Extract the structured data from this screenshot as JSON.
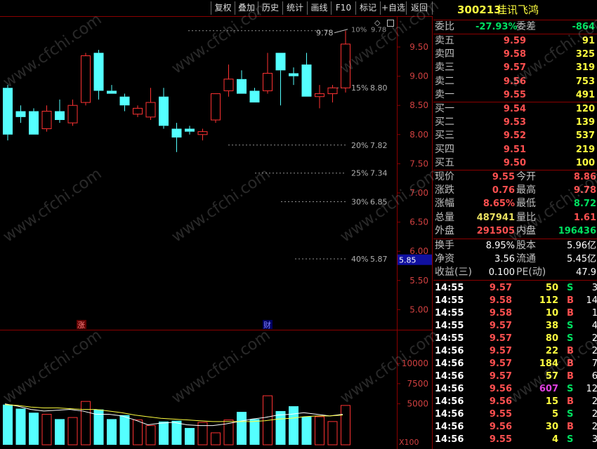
{
  "toolbar": {
    "items": [
      "复权",
      "叠加",
      "历史",
      "统计",
      "画线",
      "F10",
      "标记",
      "+自选",
      "返回"
    ]
  },
  "stock": {
    "code": "300213",
    "name": "佳讯飞鸿"
  },
  "weibi": {
    "label1": "委比",
    "value1": "-27.93%",
    "label2": "委差",
    "value2": "-864"
  },
  "sell": [
    {
      "label": "卖五",
      "price": "9.59",
      "vol": "91"
    },
    {
      "label": "卖四",
      "price": "9.58",
      "vol": "325"
    },
    {
      "label": "卖三",
      "price": "9.57",
      "vol": "319"
    },
    {
      "label": "卖二",
      "price": "9.56",
      "vol": "753"
    },
    {
      "label": "卖一",
      "price": "9.55",
      "vol": "491"
    }
  ],
  "buy": [
    {
      "label": "买一",
      "price": "9.54",
      "vol": "120"
    },
    {
      "label": "买二",
      "price": "9.53",
      "vol": "139"
    },
    {
      "label": "买三",
      "price": "9.52",
      "vol": "537"
    },
    {
      "label": "买四",
      "price": "9.51",
      "vol": "219"
    },
    {
      "label": "买五",
      "price": "9.50",
      "vol": "100"
    }
  ],
  "quote": [
    {
      "l1": "现价",
      "v1": "9.55",
      "c1": "#ff5050",
      "l2": "今开",
      "v2": "8.86",
      "c2": "#ff5050"
    },
    {
      "l1": "涨跌",
      "v1": "0.76",
      "c1": "#ff5050",
      "l2": "最高",
      "v2": "9.78",
      "c2": "#ff5050"
    },
    {
      "l1": "涨幅",
      "v1": "8.65%",
      "c1": "#ff5050",
      "l2": "最低",
      "v2": "8.72",
      "c2": "#00e060"
    },
    {
      "l1": "总量",
      "v1": "487941",
      "c1": "#e8e060",
      "l2": "量比",
      "v2": "1.61",
      "c2": "#ff5050"
    },
    {
      "l1": "外盘",
      "v1": "291505",
      "c1": "#ff5050",
      "l2": "内盘",
      "v2": "196436",
      "c2": "#00e060"
    }
  ],
  "fund": [
    {
      "l1": "换手",
      "v1": "8.95%",
      "l2": "股本",
      "v2": "5.96亿"
    },
    {
      "l1": "净资",
      "v1": "3.56",
      "l2": "流通",
      "v2": "5.45亿"
    },
    {
      "l1": "收益(三)",
      "v1": "0.100",
      "l2": "PE(动)",
      "v2": "47.9"
    }
  ],
  "ticks": [
    {
      "t": "14:55",
      "p": "9.57",
      "v": "50",
      "s": "S",
      "n": "3"
    },
    {
      "t": "14:55",
      "p": "9.58",
      "v": "112",
      "s": "B",
      "n": "14"
    },
    {
      "t": "14:55",
      "p": "9.58",
      "v": "10",
      "s": "B",
      "n": "1"
    },
    {
      "t": "14:55",
      "p": "9.57",
      "v": "38",
      "s": "S",
      "n": "4"
    },
    {
      "t": "14:55",
      "p": "9.57",
      "v": "80",
      "s": "S",
      "n": "2"
    },
    {
      "t": "14:56",
      "p": "9.57",
      "v": "22",
      "s": "B",
      "n": "2"
    },
    {
      "t": "14:56",
      "p": "9.57",
      "v": "184",
      "s": "B",
      "n": "7"
    },
    {
      "t": "14:56",
      "p": "9.57",
      "v": "57",
      "s": "B",
      "n": "6"
    },
    {
      "t": "14:56",
      "p": "9.56",
      "v": "607",
      "s": "S",
      "n": "12"
    },
    {
      "t": "14:56",
      "p": "9.56",
      "v": "15",
      "s": "B",
      "n": "2"
    },
    {
      "t": "14:56",
      "p": "9.55",
      "v": "5",
      "s": "S",
      "n": "2"
    },
    {
      "t": "14:56",
      "p": "9.56",
      "v": "30",
      "s": "B",
      "n": "2"
    },
    {
      "t": "14:56",
      "p": "9.55",
      "v": "4",
      "s": "S",
      "n": "3"
    }
  ],
  "colors": {
    "up": "#ff3232",
    "down": "#54ffff",
    "bg": "#000000",
    "grid": "#8b0000",
    "flat": "#ffffff"
  },
  "watermark": "www.cfchi.com",
  "chart_data": {
    "type": "candlestick",
    "price_axis": {
      "ticks": [
        "9.50",
        "9.00",
        "8.50",
        "8.00",
        "7.50",
        "7.00",
        "6.50",
        "6.00",
        "5.50",
        "5.00"
      ],
      "ylim": [
        4.6,
        9.95
      ]
    },
    "current_price_marker": "5.85",
    "high_label": "9.78",
    "retracements": [
      {
        "label": "10%",
        "value": "9.78"
      },
      {
        "label": "15%",
        "value": "8.80"
      },
      {
        "label": "20%",
        "value": "7.82"
      },
      {
        "label": "25%",
        "value": "7.34"
      },
      {
        "label": "30%",
        "value": "6.85"
      },
      {
        "label": "40%",
        "value": "5.87"
      }
    ],
    "event_markers": [
      "涨",
      "财"
    ],
    "candles": [
      {
        "o": 8.8,
        "h": 8.85,
        "l": 7.9,
        "c": 8.0
      },
      {
        "o": 8.4,
        "h": 8.5,
        "l": 8.2,
        "c": 8.3
      },
      {
        "o": 8.4,
        "h": 8.45,
        "l": 8.0,
        "c": 8.0
      },
      {
        "o": 8.1,
        "h": 8.5,
        "l": 8.05,
        "c": 8.4
      },
      {
        "o": 8.4,
        "h": 8.6,
        "l": 8.2,
        "c": 8.25
      },
      {
        "o": 8.2,
        "h": 8.6,
        "l": 8.15,
        "c": 8.5
      },
      {
        "o": 8.55,
        "h": 9.4,
        "l": 8.5,
        "c": 9.35
      },
      {
        "o": 9.4,
        "h": 9.45,
        "l": 8.6,
        "c": 8.75
      },
      {
        "o": 8.75,
        "h": 8.85,
        "l": 8.7,
        "c": 8.7
      },
      {
        "o": 8.65,
        "h": 8.7,
        "l": 8.4,
        "c": 8.5
      },
      {
        "o": 8.35,
        "h": 8.5,
        "l": 8.3,
        "c": 8.45
      },
      {
        "o": 8.3,
        "h": 8.8,
        "l": 8.25,
        "c": 8.55
      },
      {
        "o": 8.65,
        "h": 8.8,
        "l": 8.1,
        "c": 8.15
      },
      {
        "o": 8.1,
        "h": 8.2,
        "l": 7.7,
        "c": 7.95
      },
      {
        "o": 8.1,
        "h": 8.15,
        "l": 8.0,
        "c": 8.05
      },
      {
        "o": 8.0,
        "h": 8.1,
        "l": 7.9,
        "c": 8.05
      },
      {
        "o": 8.25,
        "h": 8.7,
        "l": 8.2,
        "c": 8.7
      },
      {
        "o": 8.75,
        "h": 9.2,
        "l": 8.65,
        "c": 8.95
      },
      {
        "o": 8.95,
        "h": 9.1,
        "l": 8.7,
        "c": 8.7
      },
      {
        "o": 8.75,
        "h": 8.8,
        "l": 8.55,
        "c": 8.55
      },
      {
        "o": 8.75,
        "h": 9.4,
        "l": 8.7,
        "c": 9.05
      },
      {
        "o": 9.4,
        "h": 9.4,
        "l": 8.5,
        "c": 9.1
      },
      {
        "o": 9.05,
        "h": 9.15,
        "l": 8.85,
        "c": 9.0
      },
      {
        "o": 9.2,
        "h": 9.4,
        "l": 8.65,
        "c": 8.65
      },
      {
        "o": 8.65,
        "h": 8.85,
        "l": 8.45,
        "c": 8.7
      },
      {
        "o": 8.7,
        "h": 8.85,
        "l": 8.55,
        "c": 8.8
      },
      {
        "o": 8.8,
        "h": 9.78,
        "l": 8.72,
        "c": 9.55
      }
    ],
    "volume_axis": {
      "ticks": [
        "10000",
        "7500",
        "5000"
      ],
      "unit": "X100",
      "ylim": [
        0,
        13500
      ]
    },
    "volume": [
      4900,
      4400,
      3900,
      3700,
      3100,
      3300,
      5300,
      4300,
      3100,
      3600,
      3000,
      2300,
      2800,
      2900,
      2000,
      2700,
      1400,
      3000,
      4000,
      3100,
      6000,
      4100,
      4700,
      3400,
      3400,
      2800,
      4800
    ],
    "ma5": [
      5000,
      4700,
      4300,
      4100,
      4200,
      4300,
      4100,
      3700,
      3700,
      3500,
      3000,
      2400,
      2600,
      2700,
      2400,
      2300,
      2300,
      2500,
      2800,
      3100,
      3300,
      3600,
      3700,
      3900,
      3700,
      3500,
      3700
    ],
    "ma10": [
      4900,
      4800,
      4600,
      4500,
      4500,
      4400,
      4300,
      4300,
      4100,
      3900,
      3600,
      3400,
      3200,
      3100,
      3000,
      2900,
      2800,
      2800,
      2800,
      2800,
      2900,
      3100,
      3200,
      3400,
      3500,
      3500,
      3600
    ]
  }
}
